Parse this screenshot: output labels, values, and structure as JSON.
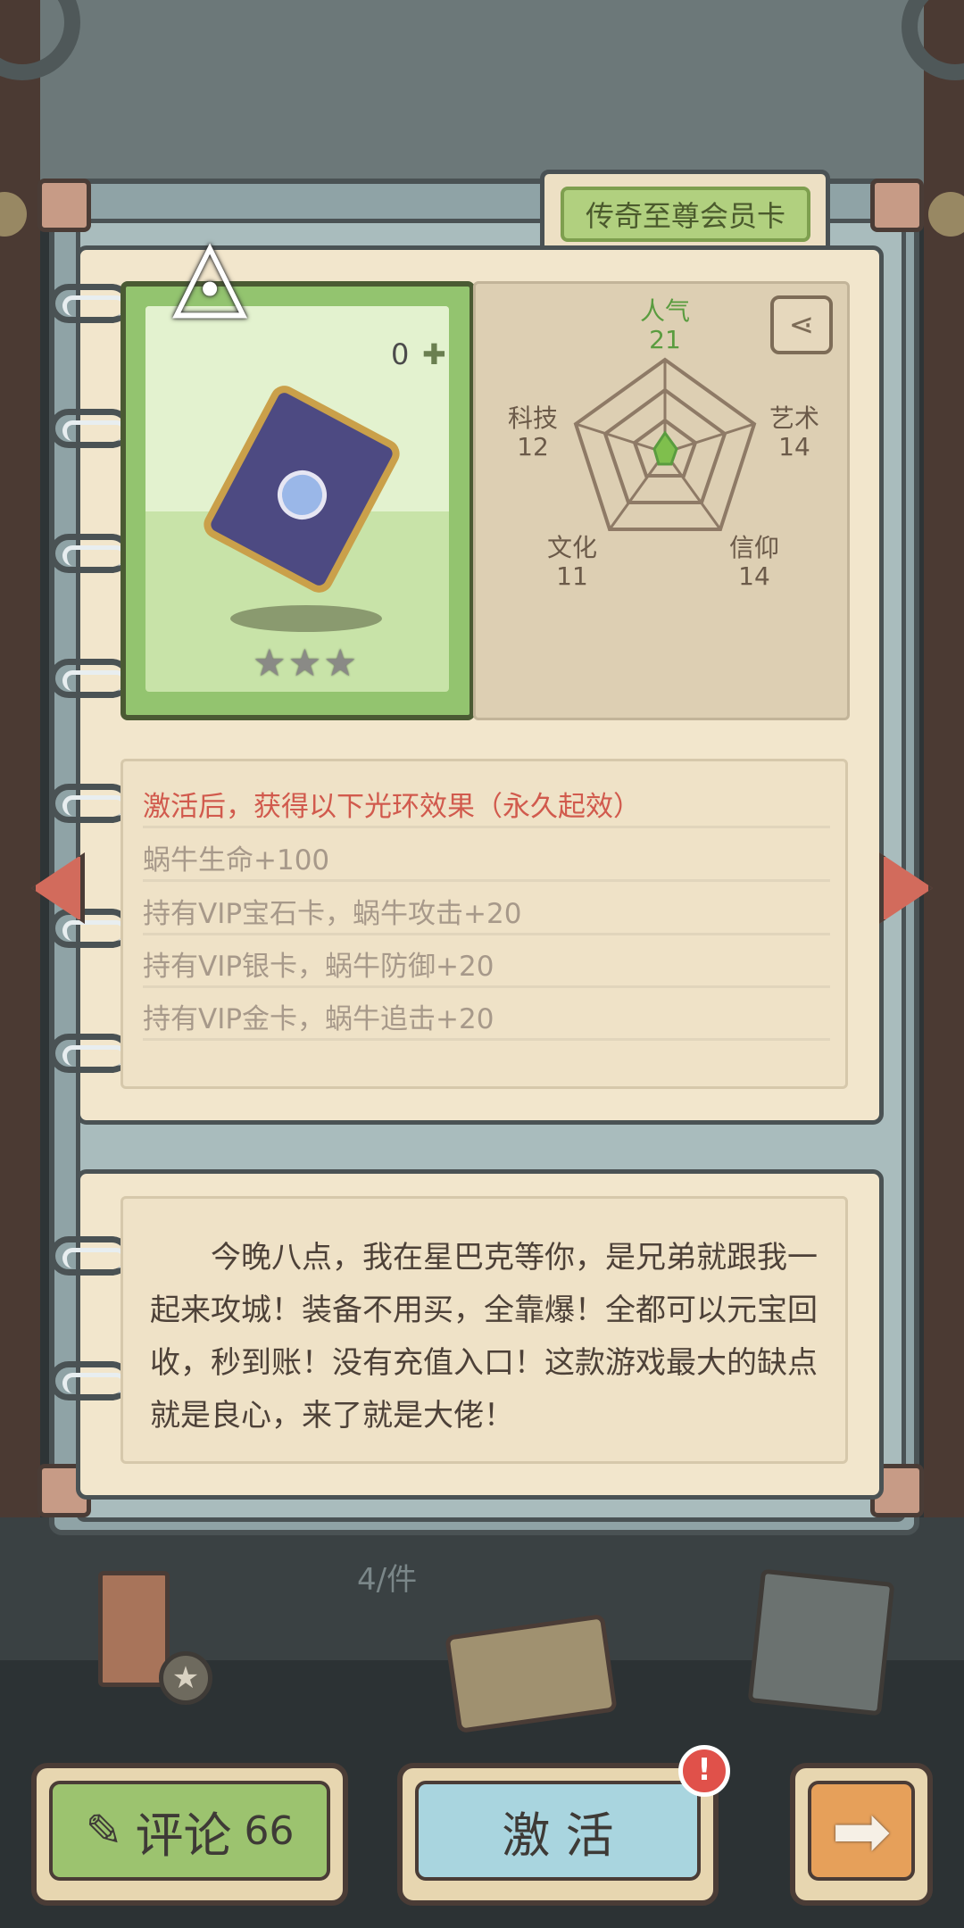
{
  "card": {
    "title": "传奇至尊会员卡",
    "count": "0",
    "stars": 3,
    "item_icon": "vip-card-icon",
    "badge_icon": "rank-badge-icon"
  },
  "stats": {
    "popularity": {
      "label": "人气",
      "value": "21"
    },
    "art": {
      "label": "艺术",
      "value": "14"
    },
    "faith": {
      "label": "信仰",
      "value": "14"
    },
    "culture": {
      "label": "文化",
      "value": "11"
    },
    "tech": {
      "label": "科技",
      "value": "12"
    }
  },
  "effects": {
    "header": "激活后，获得以下光环效果（永久起效）",
    "lines": [
      "蜗牛生命+100",
      "持有VIP宝石卡，蜗牛攻击+20",
      "持有VIP银卡，蜗牛防御+20",
      "持有VIP金卡，蜗牛追击+20"
    ]
  },
  "description": "今晚八点，我在星巴克等你，是兄弟就跟我一起来攻城！装备不用买，全靠爆！全都可以元宝回收，秒到账！没有充值入口！这款游戏最大的缺点就是良心，来了就是大佬！",
  "pager": "4/件",
  "buttons": {
    "comment_label": "评论",
    "comment_count": "66",
    "activate_label": "激 活",
    "alert": "!"
  },
  "colors": {
    "highlight_stat": "#5a9c3f",
    "effect_header": "#d15a4d",
    "card_green": "#93c46f"
  }
}
